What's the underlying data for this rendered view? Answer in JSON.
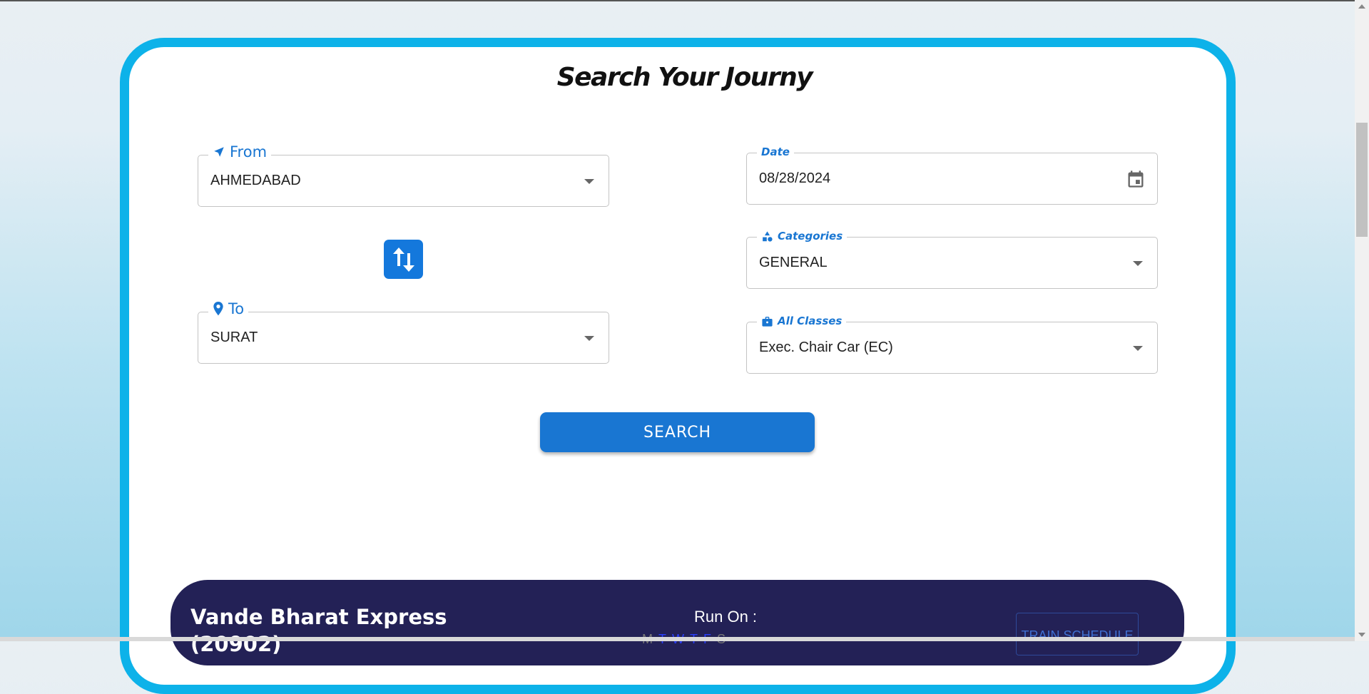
{
  "title": "Search Your Journy",
  "form": {
    "from": {
      "label": "From",
      "value": "AHMEDABAD",
      "icon": "navigation-arrow-icon"
    },
    "to": {
      "label": "To",
      "value": "SURAT",
      "icon": "location-pin-icon"
    },
    "date": {
      "label": "Date",
      "value": "08/28/2024",
      "icon": "calendar-icon"
    },
    "category": {
      "label": "Categories",
      "value": "GENERAL",
      "icon": "category-shapes-icon"
    },
    "class": {
      "label": "All Classes",
      "value": "Exec. Chair Car (EC)",
      "icon": "briefcase-icon"
    },
    "swap_icon": "swap-vertical-icon",
    "search_label": "SEARCH"
  },
  "result": {
    "train_name": "Vande Bharat Express",
    "train_number": "(20902)",
    "run_on_label": "Run On :",
    "days": [
      "M",
      "T",
      "W",
      "T",
      "F",
      "S"
    ],
    "schedule_label": "TRAIN SCHEDULE"
  },
  "colors": {
    "accent": "#1976d2",
    "card_border": "#0db2e9",
    "result_bg": "#232156"
  }
}
